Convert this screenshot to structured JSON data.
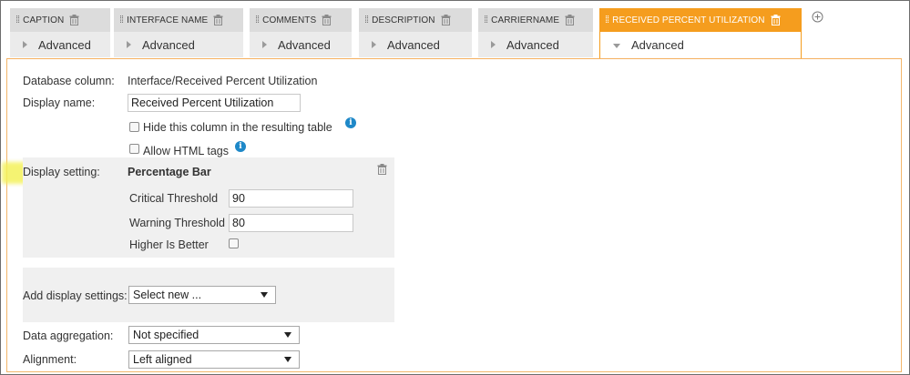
{
  "tabs": [
    {
      "title": "CAPTION",
      "sub": "Advanced"
    },
    {
      "title": "INTERFACE NAME",
      "sub": "Advanced"
    },
    {
      "title": "COMMENTS",
      "sub": "Advanced"
    },
    {
      "title": "DESCRIPTION",
      "sub": "Advanced"
    },
    {
      "title": "CARRIERNAME",
      "sub": "Advanced"
    },
    {
      "title": "RECEIVED PERCENT UTILIZATION",
      "sub": "Advanced"
    }
  ],
  "form": {
    "database_column_label": "Database column:",
    "database_column_value": "Interface/Received Percent Utilization",
    "display_name_label": "Display name:",
    "display_name_value": "Received Percent Utilization",
    "hide_column_label": "Hide this column in the resulting table",
    "allow_html_label": "Allow HTML tags",
    "display_setting_label": "Display setting:",
    "display_setting_title": "Percentage Bar",
    "critical_threshold_label": "Critical Threshold",
    "critical_threshold_value": "90",
    "warning_threshold_label": "Warning Threshold",
    "warning_threshold_value": "80",
    "higher_is_better_label": "Higher Is Better",
    "add_display_settings_label": "Add display settings:",
    "add_display_settings_value": "Select new ...",
    "data_aggregation_label": "Data aggregation:",
    "data_aggregation_value": "Not specified",
    "alignment_label": "Alignment:",
    "alignment_value": "Left aligned"
  },
  "colors": {
    "active_tab": "#f59d1e",
    "tab_bg": "#dcdcdc",
    "info_icon": "#1e88c8",
    "highlight": "#f4f15a"
  }
}
